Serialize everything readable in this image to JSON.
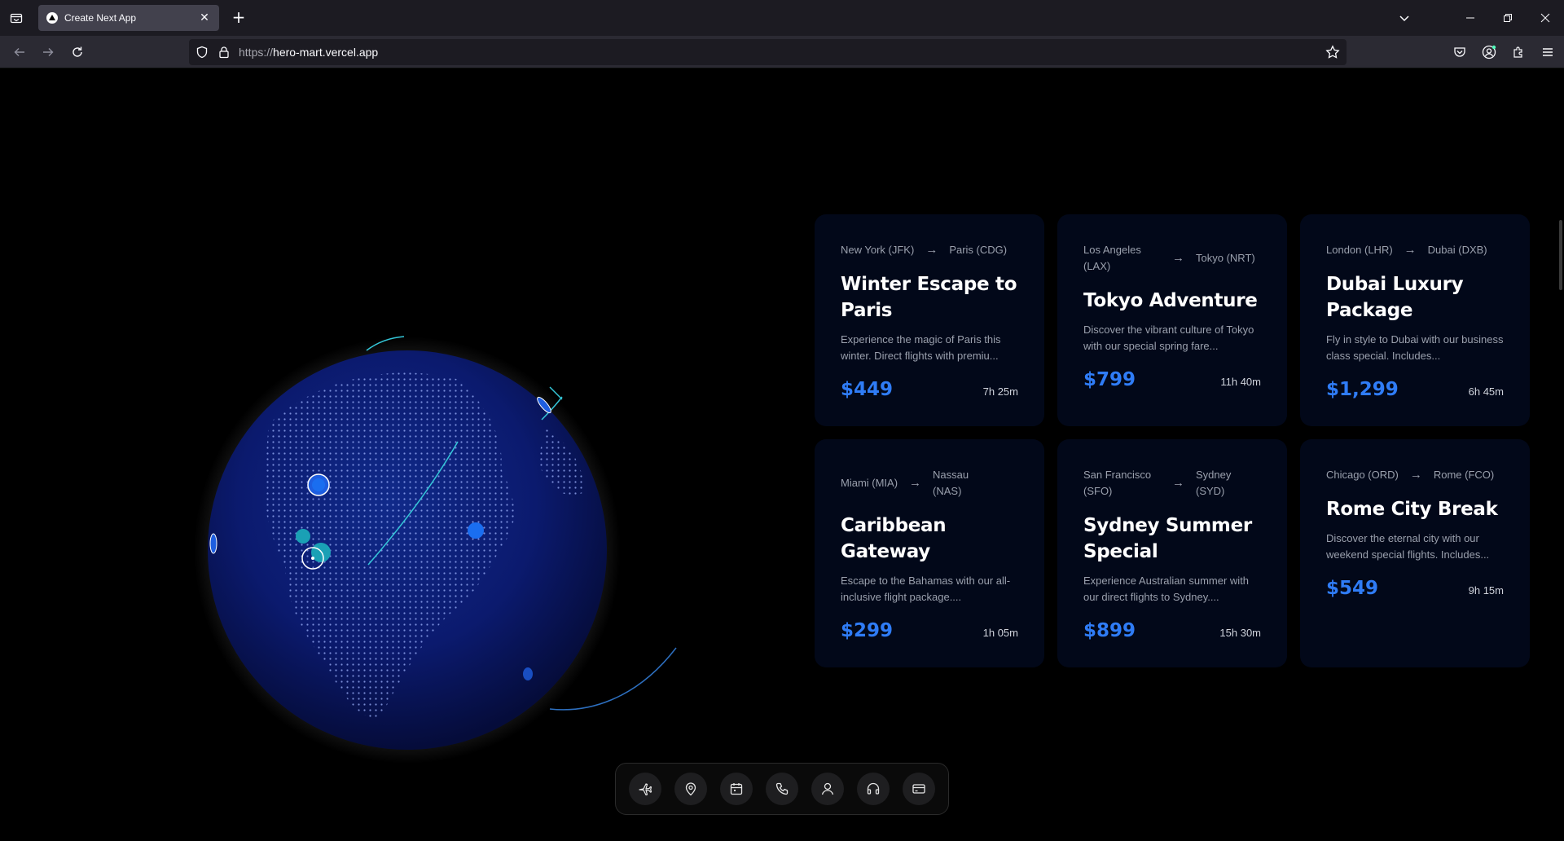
{
  "browser": {
    "tab_title": "Create Next App",
    "url_protocol": "https://",
    "url_host": "hero-mart.vercel.app"
  },
  "cards": [
    {
      "from": "New York (JFK)",
      "to": "Paris (CDG)",
      "title": "Winter Escape to Paris",
      "description": "Experience the magic of Paris this winter. Direct flights with premiu...",
      "price": "$449",
      "duration": "7h 25m"
    },
    {
      "from": "Los Angeles (LAX)",
      "to": "Tokyo (NRT)",
      "title": "Tokyo Adventure",
      "description": "Discover the vibrant culture of Tokyo with our special spring fare...",
      "price": "$799",
      "duration": "11h 40m"
    },
    {
      "from": "London (LHR)",
      "to": "Dubai (DXB)",
      "title": "Dubai Luxury Package",
      "description": "Fly in style to Dubai with our business class special. Includes...",
      "price": "$1,299",
      "duration": "6h 45m"
    },
    {
      "from": "Miami (MIA)",
      "to": "Nassau (NAS)",
      "title": "Caribbean Gateway",
      "description": "Escape to the Bahamas with our all-inclusive flight package....",
      "price": "$299",
      "duration": "1h 05m"
    },
    {
      "from": "San Francisco (SFO)",
      "to": "Sydney (SYD)",
      "title": "Sydney Summer Special",
      "description": "Experience Australian summer with our direct flights to Sydney....",
      "price": "$899",
      "duration": "15h 30m"
    },
    {
      "from": "Chicago (ORD)",
      "to": "Rome (FCO)",
      "title": "Rome City Break",
      "description": "Discover the eternal city with our weekend special flights. Includes...",
      "price": "$549",
      "duration": "9h 15m"
    }
  ],
  "route_arrow": "→",
  "dock_icons": [
    "plane-icon",
    "map-pin-icon",
    "calendar-icon",
    "phone-icon",
    "user-icon",
    "headset-icon",
    "card-icon"
  ],
  "colors": {
    "accent_price": "#2f7cf6",
    "card_bg": "#020819",
    "globe": "#0b1a6e"
  }
}
